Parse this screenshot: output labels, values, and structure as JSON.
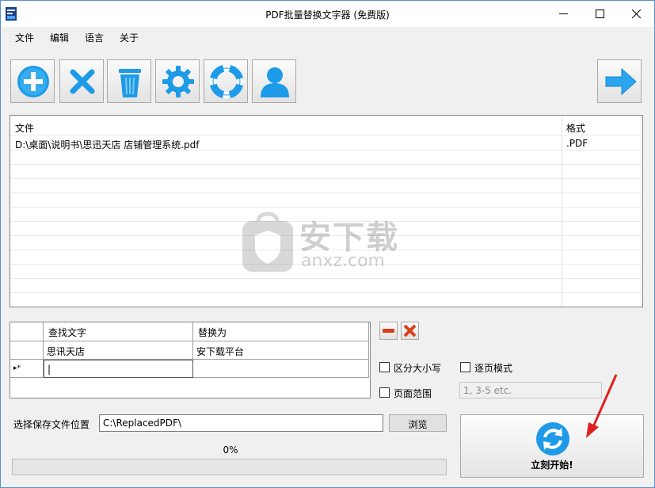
{
  "window": {
    "title": "PDF批量替换文字器 (免费版)"
  },
  "menu": [
    "文件",
    "编辑",
    "语言",
    "关于"
  ],
  "toolbar": {
    "buttons": [
      "add-icon",
      "remove-icon",
      "trash-icon",
      "gear-icon",
      "lifebuoy-icon",
      "user-icon",
      "next-arrow-icon"
    ]
  },
  "file_list": {
    "columns": [
      "文件",
      "格式"
    ],
    "rows": [
      {
        "file": "D:\\桌面\\说明书\\思迅天店 店铺管理系统.pdf",
        "format": ".PDF"
      }
    ]
  },
  "watermark": {
    "text": "安下载",
    "sub": "anxz.com"
  },
  "replace_grid": {
    "columns": [
      "查找文字",
      "替换为"
    ],
    "rows": [
      {
        "find": "思讯天店",
        "replace": "安下载平台"
      },
      {
        "marker": "▸*",
        "find": "|",
        "replace": ""
      }
    ]
  },
  "options": {
    "case_sensitive": "区分大小写",
    "page_mode": "逐页模式",
    "page_range": "页面范围",
    "range_placeholder": "1, 3-5 etc."
  },
  "save": {
    "label": "选择保存文件位置",
    "path": "C:\\ReplacedPDF\\",
    "browse": "浏览"
  },
  "progress": {
    "text": "0%",
    "value": 0
  },
  "start": {
    "label": "立刻开始!"
  },
  "colors": {
    "accent": "#1e9be8",
    "remove_red": "#d9401a",
    "arrow_red": "#e02020",
    "progress": "#06b025"
  }
}
